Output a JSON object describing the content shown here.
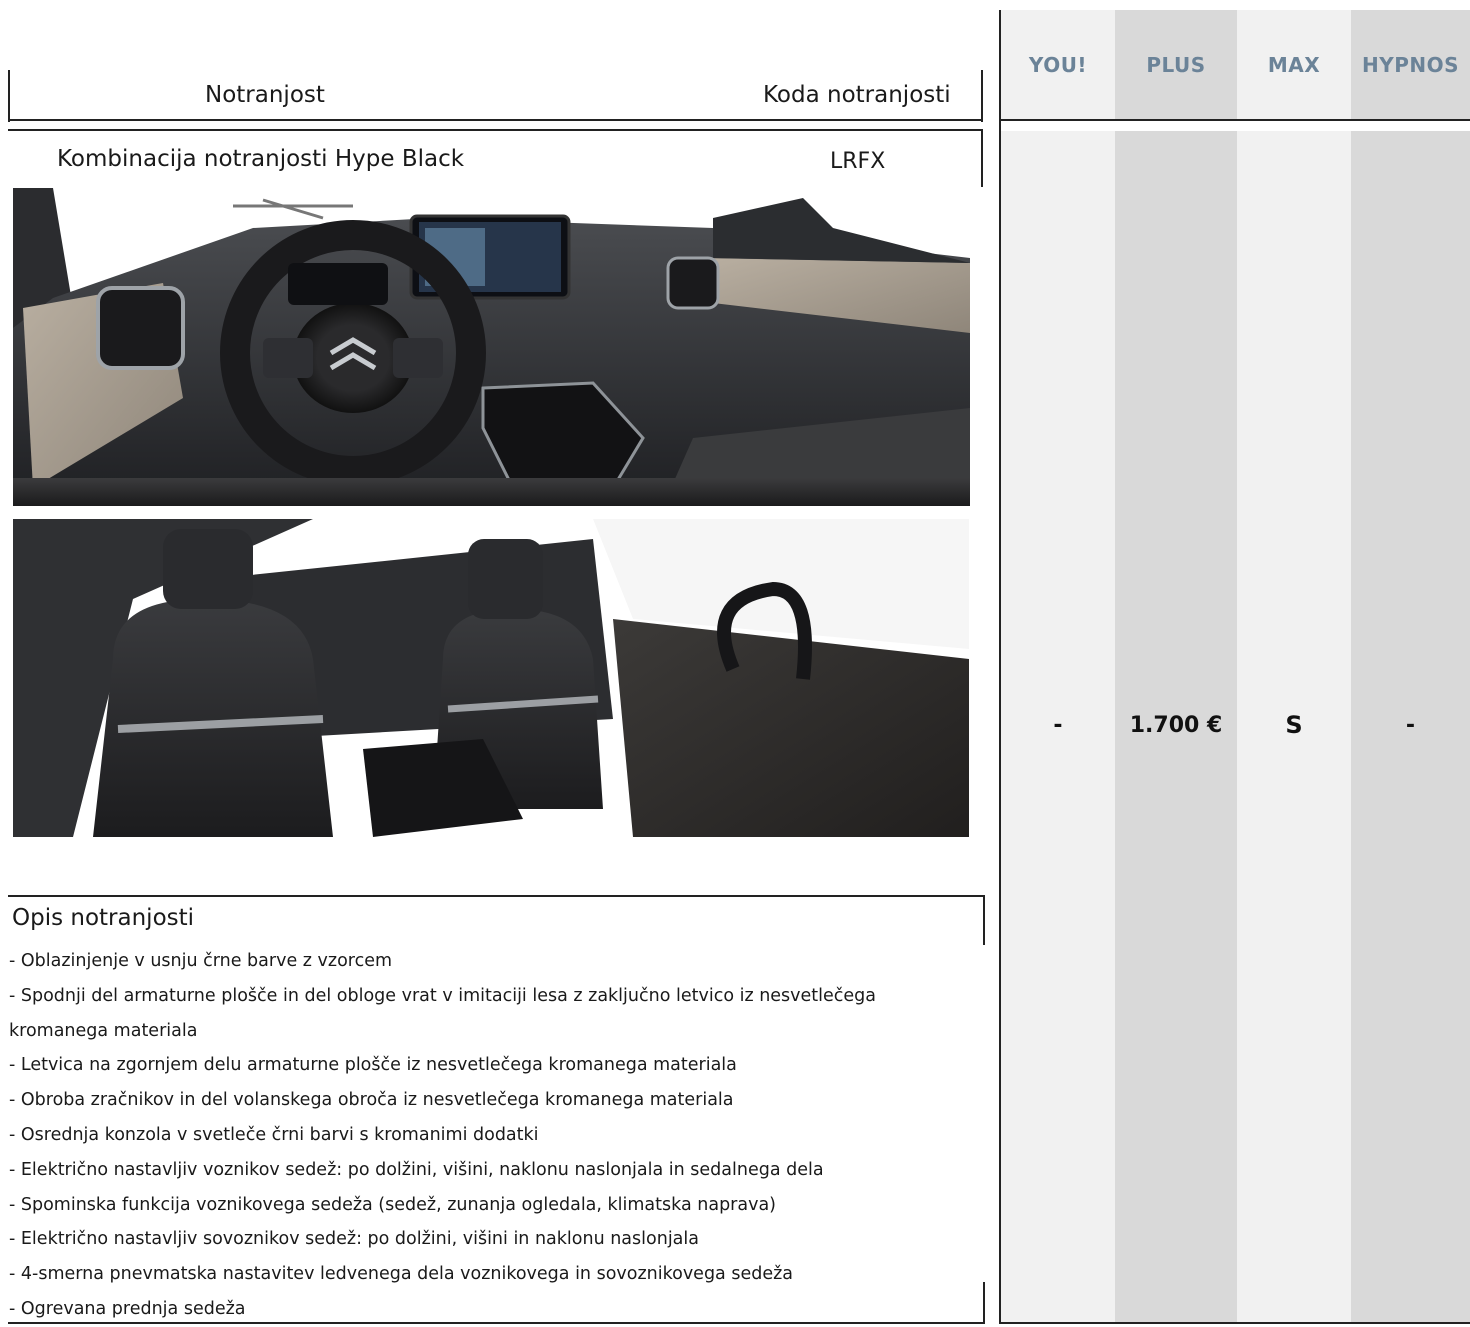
{
  "header": {
    "interior_label": "Notranjost",
    "code_label": "Koda notranjosti"
  },
  "trim": {
    "name": "Kombinacija notranjosti Hype Black",
    "code": "LRFX"
  },
  "photos": [
    {
      "name": "dashboard-photo"
    },
    {
      "name": "seats-photo"
    }
  ],
  "description": {
    "title": "Opis notranjosti",
    "items": [
      "- Oblazinjenje v usnju črne barve z vzorcem",
      "- Spodnji del armaturne plošče in del obloge vrat v imitaciji lesa z zaključno letvico iz nesvetlečega kromanega materiala",
      "- Letvica na zgornjem delu armaturne plošče iz nesvetlečega kromanega materiala",
      "- Obroba zračnikov in del volanskega obroča iz nesvetlečega kromanega materiala",
      "- Osrednja konzola v svetleče črni barvi s kromanimi dodatki",
      "- Električno nastavljiv voznikov sedež: po dolžini, višini, naklonu naslonjala in sedalnega dela",
      "- Spominska funkcija voznikovega sedeža (sedež, zunanja ogledala, klimatska naprava)",
      "- Električno nastavljiv sovoznikov sedež: po dolžini, višini in naklonu naslonjala",
      "- 4-smerna pnevmatska nastavitev ledvenega dela voznikovega in sovoznikovega sedeža",
      "- Ogrevana prednja sedeža"
    ]
  },
  "table": {
    "columns": [
      {
        "label": "YOU!",
        "value": "-",
        "bg": "#f1f1f1"
      },
      {
        "label": "PLUS",
        "value": "1.700 €",
        "bg": "#d9d9d9"
      },
      {
        "label": "MAX",
        "value": "S",
        "bg": "#f1f1f1"
      },
      {
        "label": "HYPNOS",
        "value": "-",
        "bg": "#d9d9d9"
      }
    ],
    "header_color": "#6b8398"
  }
}
